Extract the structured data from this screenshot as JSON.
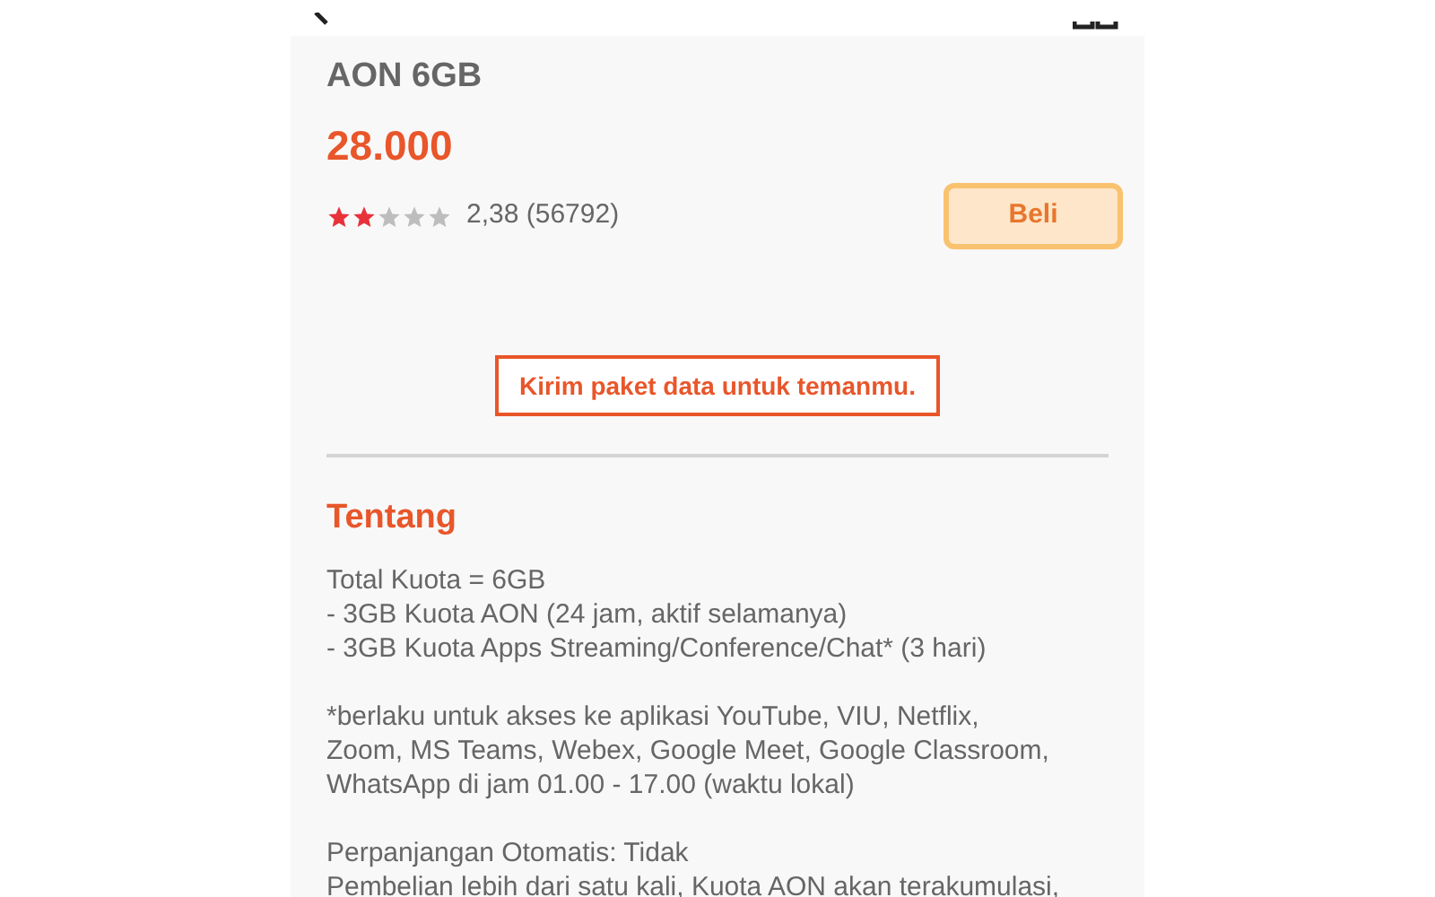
{
  "product": {
    "title": "AON 6GB",
    "price": "28.000",
    "stars": 2,
    "rating": "2,38 (56792)",
    "buy_button": "Beli"
  },
  "gift_button": "Kirim paket data untuk temanmu.",
  "about": {
    "heading": "Tentang",
    "paragraphs": [
      [
        "Total Kuota = 6GB",
        "- 3GB Kuota AON (24 jam, aktif selamanya)",
        "- 3GB Kuota Apps Streaming/Conference/Chat* (3 hari)"
      ],
      [
        "*berlaku untuk akses ke aplikasi YouTube, VIU, Netflix,",
        "Zoom, MS Teams, Webex, Google Meet, Google Classroom,",
        "WhatsApp di jam 01.00 - 17.00 (waktu lokal)"
      ],
      [
        "Perpanjangan Otomatis: Tidak",
        "Pembelian lebih dari satu kali, Kuota AON akan terakumulasi,"
      ]
    ]
  }
}
